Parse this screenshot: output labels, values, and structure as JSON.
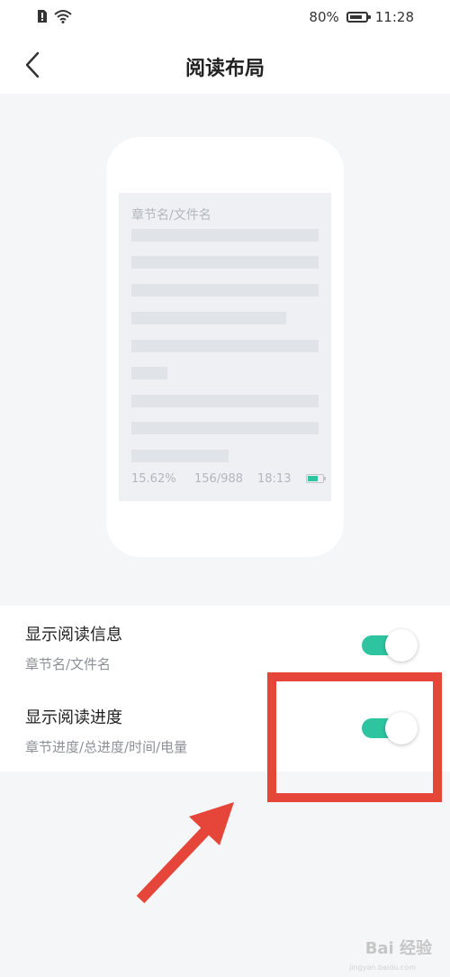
{
  "status_bar": {
    "battery_percent": "80%",
    "battery_level": 0.8,
    "time": "11:28",
    "icons": [
      "alert-sim-icon",
      "wifi-icon",
      "battery-icon"
    ]
  },
  "header": {
    "title": "阅读布局",
    "back_icon": "chevron-left-icon"
  },
  "preview": {
    "chapter_label": "章节名/文件名",
    "percent": "15.62%",
    "pages": "156/988",
    "time": "18:13",
    "battery_icon": "battery-icon"
  },
  "settings": [
    {
      "title": "显示阅读信息",
      "subtitle": "章节名/文件名",
      "enabled": true
    },
    {
      "title": "显示阅读进度",
      "subtitle": "章节进度/总进度/时间/电量",
      "enabled": true
    }
  ],
  "colors": {
    "accent": "#2ec4a0",
    "annotation": "#e6463a",
    "background": "#f5f6f8"
  },
  "watermark": {
    "text": "Bai 经验",
    "url": "jingyan.baidu.com"
  }
}
